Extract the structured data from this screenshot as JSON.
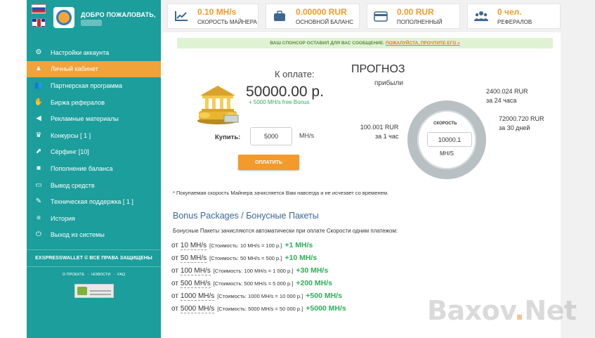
{
  "sidebar": {
    "welcome": "ДОБРО ПОЖАЛОВАТЬ,",
    "menu": [
      {
        "label": "Настройки аккаунта",
        "icon": "gears-icon",
        "active": false
      },
      {
        "label": "Личный кабинет",
        "icon": "user-icon",
        "active": true
      },
      {
        "label": "Партнерская программа",
        "icon": "users-icon",
        "active": false
      },
      {
        "label": "Биржа рефералов",
        "icon": "handshake-icon",
        "active": false
      },
      {
        "label": "Рекламные материалы",
        "icon": "bullhorn-icon",
        "active": false
      },
      {
        "label": "Конкурсы [ 1 ]",
        "icon": "trophy-icon",
        "active": false
      },
      {
        "label": "Сёрфинг [10]",
        "icon": "external-link-icon",
        "active": false
      },
      {
        "label": "Пополнение баланса",
        "icon": "briefcase-icon",
        "active": false
      },
      {
        "label": "Вывод средств",
        "icon": "credit-card-icon",
        "active": false
      },
      {
        "label": "Техническая поддержка [ 1 ]",
        "icon": "wrench-icon",
        "active": false
      },
      {
        "label": "История",
        "icon": "list-icon",
        "active": false
      },
      {
        "label": "Выход из системы",
        "icon": "power-icon",
        "active": false
      }
    ],
    "copyright": "EXSPRESSWALLET © ВСЕ ПРАВА ЗАЩИЩЕНЫ",
    "footer_links": [
      "О ПРОЕКТЕ",
      "·",
      "НОВОСТИ",
      "·",
      "FAQ"
    ]
  },
  "stats": [
    {
      "value": "0.10 MH/s",
      "label": "СКОРОСТЬ МАЙНЕРА",
      "icon": "chart-icon"
    },
    {
      "value": "0.00000 RUR",
      "label": "ОСНОВНОЙ БАЛАНС",
      "icon": "briefcase-icon"
    },
    {
      "value": "0.00 RUR",
      "label": "ПОПОЛНЕННЫЙ",
      "icon": "credit-card-icon"
    },
    {
      "value": "0 чел.",
      "label": "РЕФЕРАЛОВ",
      "icon": "users-icon"
    }
  ],
  "banner": {
    "text": "ВАШ СПОНСОР ОСТАВИЛ ДЛЯ ВАС СООБЩЕНИЕ.",
    "link": "ПОЖАЛУЙСТА, ПРОЧТИТЕ ЕГО »"
  },
  "purchase": {
    "pay_label": "К оплате:",
    "amount": "50000.00 р.",
    "bonus": "+ 5000 MH/s free Bonus",
    "buy_label": "Купить:",
    "input_value": "5000",
    "unit": "MH/s",
    "button": "ОПЛАТИТЬ"
  },
  "forecast": {
    "title": "ПРОГНОЗ",
    "subtitle": "прибыли",
    "speed_label": "СКОРОСТЬ",
    "speed_value": "10000.1",
    "speed_unit": "MH/S",
    "hour_value": "100.001 RUR",
    "hour_label": "за 1 час",
    "day_value": "2400.024 RUR",
    "day_label": "за 24 часа",
    "month_value": "72000.720 RUR",
    "month_label": "за 30 дней"
  },
  "note": "* Покупаемая скорость Майнера зачисляется Вам навсегда и не исчезает со временем.",
  "bonus_packages": {
    "title": "Bonus Packages / Бонусные Пакеты",
    "description": "Бонусные Пакеты зачисляются автоматически при оплате Скорости одним платежом:",
    "rows": [
      {
        "prefix": "от",
        "speed": "10 MH/s",
        "cost": "[Стоимость: 10 MH/s = 100 р.]",
        "bonus": "+1 MH/s"
      },
      {
        "prefix": "от",
        "speed": "50 MH/s",
        "cost": "[Стоимость: 50 MH/s = 500 р.]",
        "bonus": "+10 MH/s"
      },
      {
        "prefix": "от",
        "speed": "100 MH/s",
        "cost": "[Стоимость: 100 MH/s = 1 000 р.]",
        "bonus": "+30 MH/s"
      },
      {
        "prefix": "от",
        "speed": "500 MH/s",
        "cost": "[Стоимость: 500 MH/s = 5 000 р.]",
        "bonus": "+200 MH/s"
      },
      {
        "prefix": "от",
        "speed": "1000 MH/s",
        "cost": "[Стоимость: 1000 MH/s = 10 000 р.]",
        "bonus": "+500 MH/s"
      },
      {
        "prefix": "от",
        "speed": "5000 MH/s",
        "cost": "[Стоимость: 5000 MH/s = 50 000 р.]",
        "bonus": "+5000 MH/s"
      }
    ]
  },
  "watermark": {
    "left": "Baxov",
    "dot": ".",
    "right": "Net"
  },
  "colors": {
    "sidebar": "#1b9e9c",
    "accent": "#f29a2b",
    "green": "#2eaf57",
    "donut": "#b8c0c4"
  }
}
